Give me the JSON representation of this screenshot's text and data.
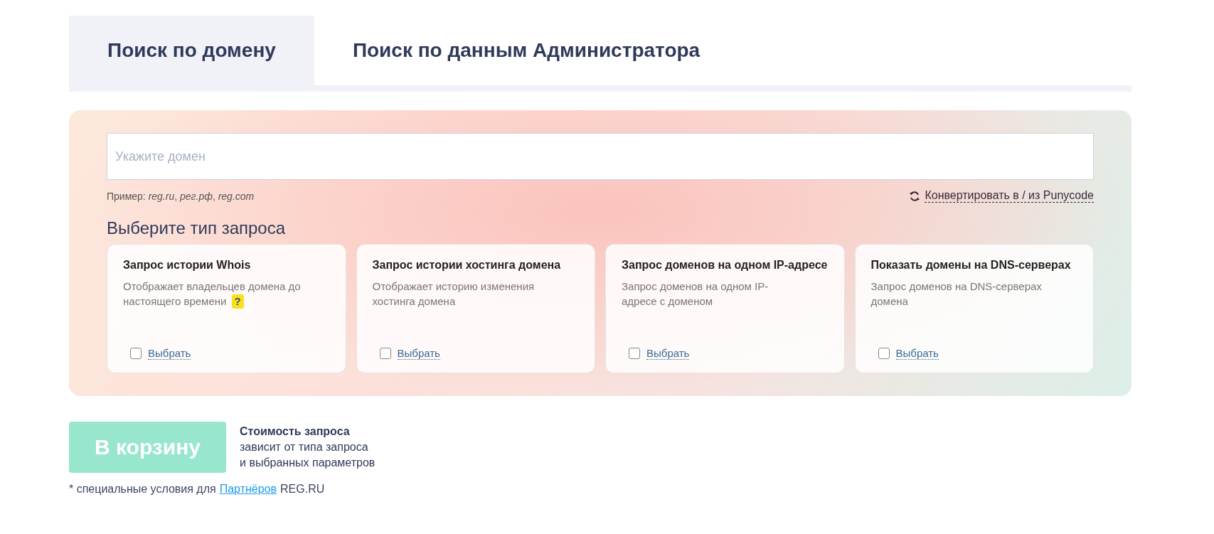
{
  "tabs": [
    {
      "label": "Поиск по домену",
      "selected": true
    },
    {
      "label": "Поиск по данным Администратора",
      "selected": false
    }
  ],
  "search": {
    "placeholder": "Укажите домен",
    "example": "Пример: *reg.ru*, *рег.рф*, *reg.com*",
    "convert_link": "Конвертировать в / из Punycode"
  },
  "query_type": {
    "heading": "Выберите тип запроса",
    "cards": [
      {
        "title": "Запрос истории Whois",
        "description": "Отображает владельцев домена до настоящего времени",
        "help": "?",
        "checked": false,
        "select_label": "Выбрать"
      },
      {
        "title": "Запрос истории хостинга домена",
        "description": "Отображает историю изменения хостинга домена",
        "checked": false,
        "select_label": "Выбрать"
      },
      {
        "title": "Запрос доменов на одном IP-адресе",
        "description": "Запрос доменов на одном IP-адресе с доменом",
        "checked": false,
        "select_label": "Выбрать"
      },
      {
        "title": "Показать домены на DNS-серверах",
        "description": "Запрос доменов на DNS-серверах домена",
        "checked": false,
        "select_label": "Выбрать"
      }
    ]
  },
  "cart_button": {
    "label": "В корзину",
    "disabled": true
  },
  "cost_note": "**Стоимость запроса**\nзависит от типа запроса\nи выбранных параметров",
  "footnote": {
    "prefix": "* специальные условия для",
    "link": "Партнёров",
    "suffix": "REG.RU"
  }
}
